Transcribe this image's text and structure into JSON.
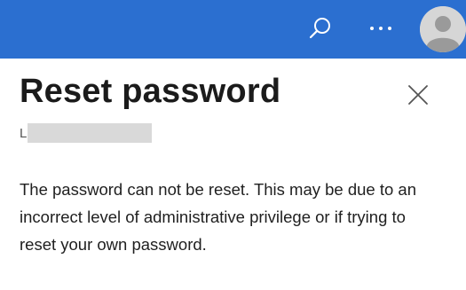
{
  "header": {
    "bar_color": "#2b6fd0",
    "icons": {
      "search": "search-icon",
      "more": "more-horizontal-icon",
      "avatar": "user-avatar-icon"
    }
  },
  "panel": {
    "title": "Reset password",
    "subtitle_prefix": "L",
    "subtitle_redacted": true,
    "close_icon": "close-icon",
    "message": "The password can not be reset. This may be due to an incorrect level of administrative privilege or if trying to reset your own password."
  }
}
